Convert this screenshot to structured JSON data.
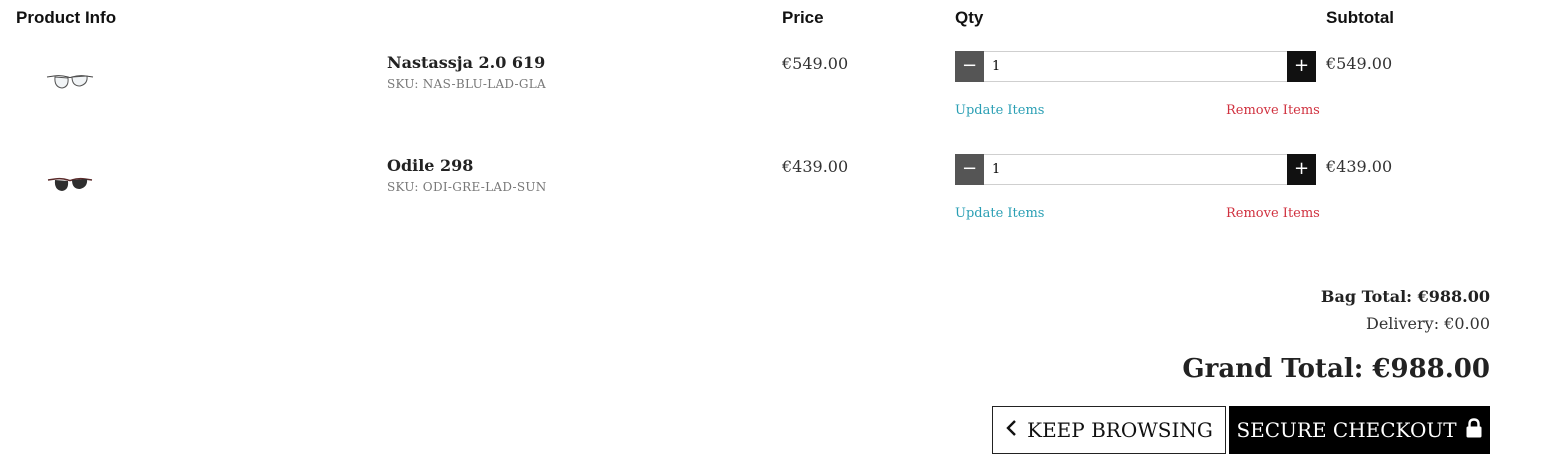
{
  "headers": {
    "product_info": "Product Info",
    "price": "Price",
    "qty": "Qty",
    "subtotal": "Subtotal"
  },
  "items": [
    {
      "name": "Nastassja 2.0 619",
      "sku": "SKU: NAS-BLU-LAD-GLA",
      "price": "€549.00",
      "qty": "1",
      "subtotal": "€549.00",
      "update_label": "Update Items",
      "remove_label": "Remove Items",
      "image_icon": "clear-eyeglasses-icon"
    },
    {
      "name": "Odile 298",
      "sku": "SKU: ODI-GRE-LAD-SUN",
      "price": "€439.00",
      "qty": "1",
      "subtotal": "€439.00",
      "update_label": "Update Items",
      "remove_label": "Remove Items",
      "image_icon": "dark-sunglasses-icon"
    }
  ],
  "qty_controls": {
    "minus": "−",
    "plus": "+"
  },
  "totals": {
    "bag_total": "Bag Total: €988.00",
    "delivery": "Delivery: €0.00",
    "grand_total": "Grand Total: €988.00"
  },
  "actions": {
    "keep_browsing": "KEEP BROWSING",
    "secure_checkout": "SECURE CHECKOUT"
  },
  "colors": {
    "update_link": "#2a9fb4",
    "remove_link": "#d0313f",
    "checkout_bg": "#000000",
    "minus_bg": "#555555",
    "plus_bg": "#111111"
  }
}
